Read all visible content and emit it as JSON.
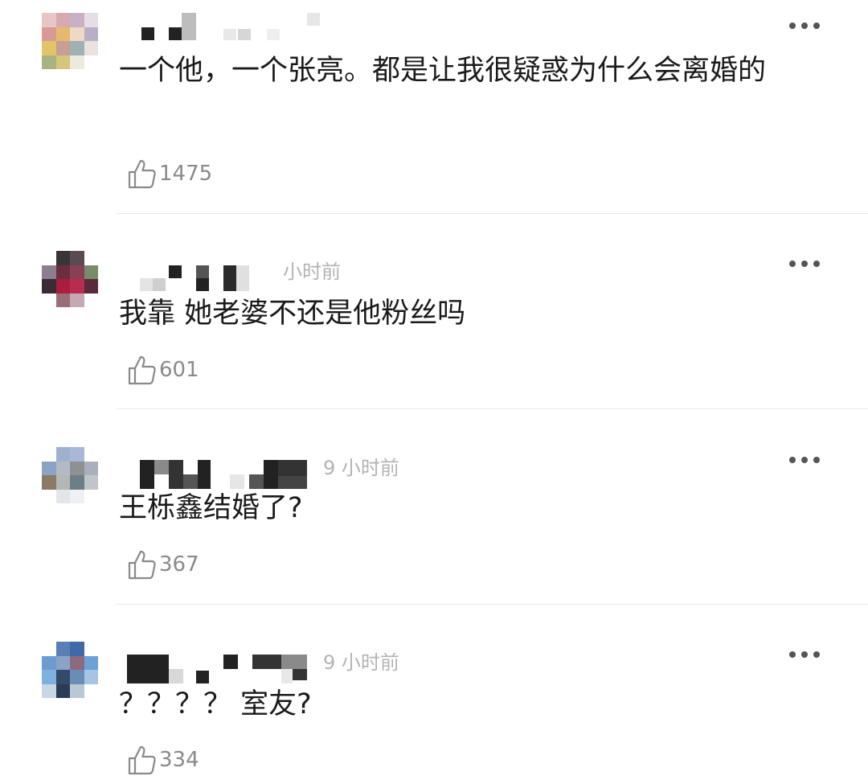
{
  "comments": [
    {
      "time": "",
      "text": "一个他，一个张亮。都是让我很疑惑为什么会离婚的",
      "likes": "1475"
    },
    {
      "time": "小时前",
      "text": "我靠 她老婆不还是他粉丝吗",
      "likes": "601"
    },
    {
      "time": "9 小时前",
      "text": "王栎鑫结婚了?",
      "likes": "367"
    },
    {
      "time": "9 小时前",
      "text": "？？？？ 室友?",
      "likes": "334"
    }
  ],
  "colors": {
    "text": "#1a1a1a",
    "meta": "#b3b3b3",
    "like": "#8a8a8a",
    "divider": "#e8e8e8"
  },
  "icons": {
    "like": "thumbs-up-icon",
    "more": "more-dots-icon",
    "avatar": "pixelated-avatar"
  }
}
